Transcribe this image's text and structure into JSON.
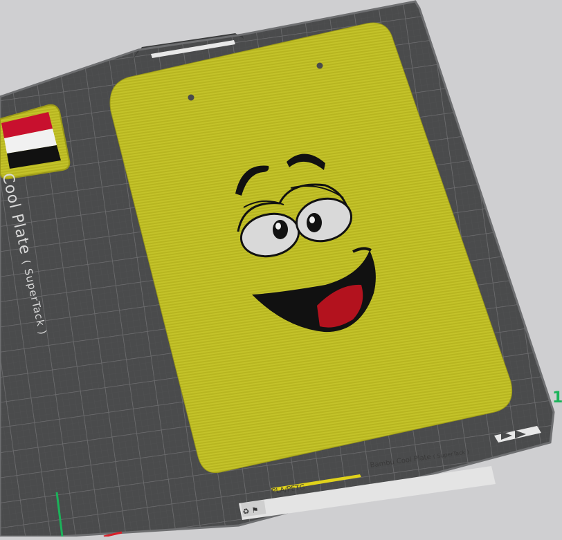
{
  "bed": {
    "name": "Cool Plate",
    "name_sub": "( SuperTack )",
    "footer_name": "Bambu Cool Plate",
    "footer_sub": "( SuperTack )",
    "material_tag": "PLA/PETG"
  },
  "axes": {
    "y_indicator_label": "1"
  },
  "colors": {
    "background": "#cfcfd1",
    "plate": "#4a4b4c",
    "grid_line": "#8a8a8c",
    "model_yellow": "#b9b822",
    "flag_red": "#c8102e",
    "flag_white": "#f1f1f1",
    "flag_black": "#111111",
    "axis_green": "#1bb35a",
    "axis_red": "#d8202a"
  },
  "objects": [
    {
      "name": "smiley-face-plate",
      "kind": "3d-model"
    },
    {
      "name": "egypt-flag-tile",
      "kind": "3d-model"
    }
  ]
}
